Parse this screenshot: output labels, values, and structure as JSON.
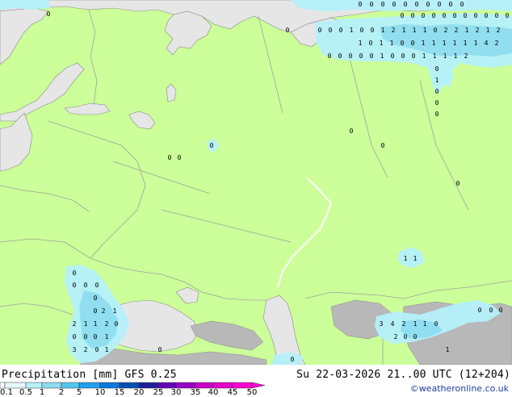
{
  "title": {
    "product": "Precipitation [mm]",
    "model": "GFS 0.25",
    "datetime": "Su 22-03-2026 21..00 UTC (12+204)"
  },
  "credit": "©weatheronline.co.uk",
  "colors": {
    "land": "#ccff99",
    "sea": "#e6e6e6",
    "mountain": "#b8b8b8",
    "border": "#a0a0a0",
    "coast": "#888888",
    "precip_light": "#b4f0fa",
    "precip_medium": "#8cdcf0",
    "value_text": "#000000"
  },
  "legend": {
    "labels": [
      "0.1",
      "0.5",
      "1",
      "2",
      "5",
      "10",
      "15",
      "20",
      "25",
      "30",
      "35",
      "40",
      "45",
      "50"
    ],
    "colors": [
      "#ffffff",
      "#e6fafe",
      "#b4f0fa",
      "#8cdcf0",
      "#50c8f0",
      "#1ea0f0",
      "#0a78dc",
      "#0050b4",
      "#1e1e9c",
      "#6400b4",
      "#9600c8",
      "#c800c8",
      "#e600c8",
      "#ff00d2"
    ]
  },
  "precip_values": {
    "top_row": [
      "0",
      "0",
      "0",
      "0",
      "0",
      "0",
      "0",
      "0",
      "0",
      "0"
    ],
    "ne_row1": [
      "0",
      "0",
      "0",
      "0",
      "0",
      "0",
      "0",
      "0",
      "0",
      "0",
      "0"
    ],
    "ne_row2": [
      "0",
      "0",
      "0",
      "1",
      "0",
      "0",
      "1",
      "2",
      "1",
      "1",
      "1",
      "0",
      "2",
      "2",
      "1",
      "2",
      "1",
      "2"
    ],
    "ne_row3": [
      "1",
      "0",
      "1",
      "1",
      "0",
      "0",
      "1",
      "1",
      "1",
      "1",
      "1",
      "1",
      "4",
      "2"
    ],
    "ne_row4": [
      "0",
      "0",
      "0",
      "0",
      "0",
      "1",
      "0",
      "0",
      "0",
      "1",
      "1",
      "1",
      "1",
      "2"
    ],
    "ne_col": [
      "0",
      "1",
      "0",
      "0",
      "0"
    ],
    "mid": [
      "0",
      "0",
      "0",
      "0",
      "0",
      "0"
    ],
    "sw_block": [
      "0",
      "0",
      "0",
      "0",
      "0",
      "0",
      "2",
      "1",
      "2",
      "1",
      "1",
      "2",
      "0",
      "0",
      "0",
      "1",
      "3",
      "2",
      "0",
      "1",
      "0"
    ],
    "se_block": [
      "1",
      "1",
      "0",
      "0",
      "3",
      "4",
      "2",
      "1",
      "1",
      "0",
      "2",
      "0",
      "0",
      "1",
      "0",
      "0"
    ],
    "misc": [
      "0",
      "0",
      "0"
    ]
  }
}
